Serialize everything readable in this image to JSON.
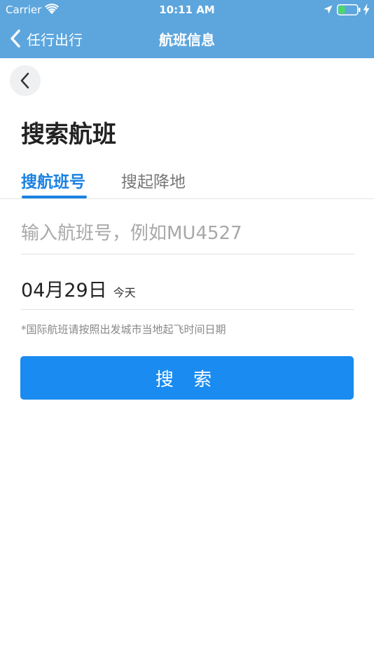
{
  "status_bar": {
    "carrier": "Carrier",
    "time": "10:11 AM",
    "battery_color": "#4cd964"
  },
  "nav_bar": {
    "back_label": "任行出行",
    "title": "航班信息",
    "background": "#5da6dd"
  },
  "page": {
    "title": "搜索航班",
    "tabs": [
      {
        "label": "搜航班号",
        "active": true
      },
      {
        "label": "搜起降地",
        "active": false
      }
    ],
    "flight_input": {
      "value": "",
      "placeholder": "输入航班号，例如MU4527"
    },
    "date": {
      "value": "04月29日",
      "relative": "今天"
    },
    "hint": "*国际航班请按照出发城市当地起飞时间日期",
    "search_button": "搜 索",
    "accent_color": "#1a82e2"
  }
}
